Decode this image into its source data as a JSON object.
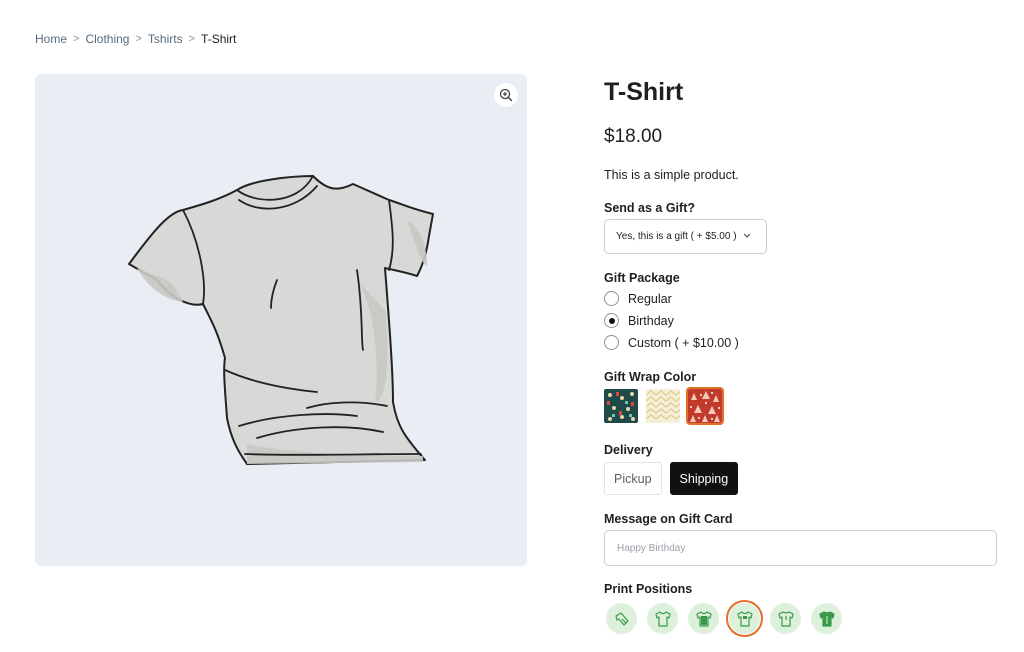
{
  "breadcrumb": {
    "items": [
      "Home",
      "Clothing",
      "Tshirts"
    ],
    "current": "T-Shirt",
    "separator": ">"
  },
  "gallery": {
    "zoom_icon": "zoom-in-icon",
    "image_alt": "T-Shirt"
  },
  "product": {
    "title": "T-Shirt",
    "price": "$18.00",
    "description": "This is a simple product."
  },
  "gift": {
    "label": "Send as a Gift?",
    "selected_option": "Yes, this is a gift ( + $5.00 )"
  },
  "gift_package": {
    "label": "Gift Package",
    "options": [
      {
        "label": "Regular",
        "checked": false
      },
      {
        "label": "Birthday",
        "checked": true
      },
      {
        "label": "Custom ( + $10.00 )",
        "checked": false
      }
    ]
  },
  "gift_wrap": {
    "label": "Gift Wrap Color",
    "swatches": [
      {
        "name": "dark-teal-pattern",
        "color": "#1f4a4a",
        "selected": false
      },
      {
        "name": "gold-chevron",
        "color": "#f3ead0",
        "selected": false
      },
      {
        "name": "red-trees",
        "color": "#c0392b",
        "selected": true
      }
    ]
  },
  "delivery": {
    "label": "Delivery",
    "options": [
      {
        "label": "Pickup",
        "active": false
      },
      {
        "label": "Shipping",
        "active": true
      }
    ]
  },
  "message": {
    "label": "Message on Gift Card",
    "placeholder": "Happy Birthday",
    "value": ""
  },
  "print_positions": {
    "label": "Print Positions",
    "options": [
      {
        "name": "sleeve",
        "selected": false
      },
      {
        "name": "front-outline",
        "selected": false
      },
      {
        "name": "front-filled",
        "selected": false
      },
      {
        "name": "front-chest",
        "selected": true
      },
      {
        "name": "back-outline",
        "selected": false
      },
      {
        "name": "back-filled",
        "selected": false
      }
    ]
  },
  "colors": {
    "accent": "#e0702a",
    "active_bg": "#111111",
    "gallery_bg": "#e8eef3",
    "position_bg": "#dcf0dc",
    "position_icon": "#3a9a4a"
  }
}
